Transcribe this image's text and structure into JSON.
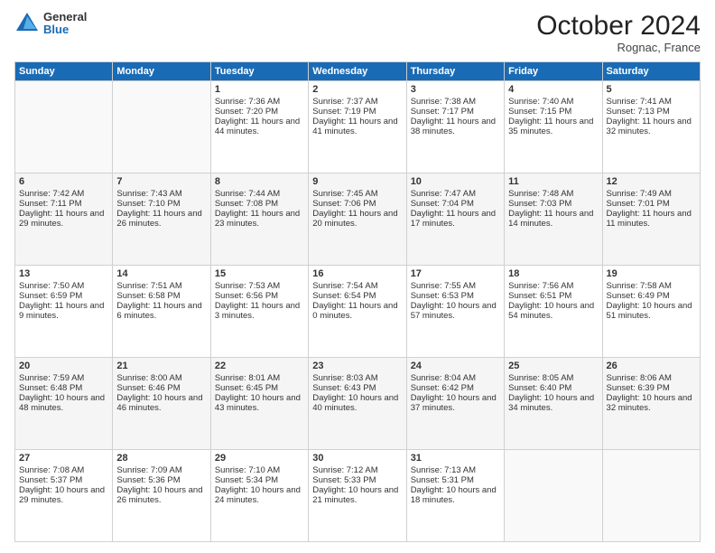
{
  "logo": {
    "general": "General",
    "blue": "Blue"
  },
  "header": {
    "month": "October 2024",
    "location": "Rognac, France"
  },
  "weekdays": [
    "Sunday",
    "Monday",
    "Tuesday",
    "Wednesday",
    "Thursday",
    "Friday",
    "Saturday"
  ],
  "weeks": [
    [
      {
        "day": "",
        "sunrise": "",
        "sunset": "",
        "daylight": ""
      },
      {
        "day": "",
        "sunrise": "",
        "sunset": "",
        "daylight": ""
      },
      {
        "day": "1",
        "sunrise": "Sunrise: 7:36 AM",
        "sunset": "Sunset: 7:20 PM",
        "daylight": "Daylight: 11 hours and 44 minutes."
      },
      {
        "day": "2",
        "sunrise": "Sunrise: 7:37 AM",
        "sunset": "Sunset: 7:19 PM",
        "daylight": "Daylight: 11 hours and 41 minutes."
      },
      {
        "day": "3",
        "sunrise": "Sunrise: 7:38 AM",
        "sunset": "Sunset: 7:17 PM",
        "daylight": "Daylight: 11 hours and 38 minutes."
      },
      {
        "day": "4",
        "sunrise": "Sunrise: 7:40 AM",
        "sunset": "Sunset: 7:15 PM",
        "daylight": "Daylight: 11 hours and 35 minutes."
      },
      {
        "day": "5",
        "sunrise": "Sunrise: 7:41 AM",
        "sunset": "Sunset: 7:13 PM",
        "daylight": "Daylight: 11 hours and 32 minutes."
      }
    ],
    [
      {
        "day": "6",
        "sunrise": "Sunrise: 7:42 AM",
        "sunset": "Sunset: 7:11 PM",
        "daylight": "Daylight: 11 hours and 29 minutes."
      },
      {
        "day": "7",
        "sunrise": "Sunrise: 7:43 AM",
        "sunset": "Sunset: 7:10 PM",
        "daylight": "Daylight: 11 hours and 26 minutes."
      },
      {
        "day": "8",
        "sunrise": "Sunrise: 7:44 AM",
        "sunset": "Sunset: 7:08 PM",
        "daylight": "Daylight: 11 hours and 23 minutes."
      },
      {
        "day": "9",
        "sunrise": "Sunrise: 7:45 AM",
        "sunset": "Sunset: 7:06 PM",
        "daylight": "Daylight: 11 hours and 20 minutes."
      },
      {
        "day": "10",
        "sunrise": "Sunrise: 7:47 AM",
        "sunset": "Sunset: 7:04 PM",
        "daylight": "Daylight: 11 hours and 17 minutes."
      },
      {
        "day": "11",
        "sunrise": "Sunrise: 7:48 AM",
        "sunset": "Sunset: 7:03 PM",
        "daylight": "Daylight: 11 hours and 14 minutes."
      },
      {
        "day": "12",
        "sunrise": "Sunrise: 7:49 AM",
        "sunset": "Sunset: 7:01 PM",
        "daylight": "Daylight: 11 hours and 11 minutes."
      }
    ],
    [
      {
        "day": "13",
        "sunrise": "Sunrise: 7:50 AM",
        "sunset": "Sunset: 6:59 PM",
        "daylight": "Daylight: 11 hours and 9 minutes."
      },
      {
        "day": "14",
        "sunrise": "Sunrise: 7:51 AM",
        "sunset": "Sunset: 6:58 PM",
        "daylight": "Daylight: 11 hours and 6 minutes."
      },
      {
        "day": "15",
        "sunrise": "Sunrise: 7:53 AM",
        "sunset": "Sunset: 6:56 PM",
        "daylight": "Daylight: 11 hours and 3 minutes."
      },
      {
        "day": "16",
        "sunrise": "Sunrise: 7:54 AM",
        "sunset": "Sunset: 6:54 PM",
        "daylight": "Daylight: 11 hours and 0 minutes."
      },
      {
        "day": "17",
        "sunrise": "Sunrise: 7:55 AM",
        "sunset": "Sunset: 6:53 PM",
        "daylight": "Daylight: 10 hours and 57 minutes."
      },
      {
        "day": "18",
        "sunrise": "Sunrise: 7:56 AM",
        "sunset": "Sunset: 6:51 PM",
        "daylight": "Daylight: 10 hours and 54 minutes."
      },
      {
        "day": "19",
        "sunrise": "Sunrise: 7:58 AM",
        "sunset": "Sunset: 6:49 PM",
        "daylight": "Daylight: 10 hours and 51 minutes."
      }
    ],
    [
      {
        "day": "20",
        "sunrise": "Sunrise: 7:59 AM",
        "sunset": "Sunset: 6:48 PM",
        "daylight": "Daylight: 10 hours and 48 minutes."
      },
      {
        "day": "21",
        "sunrise": "Sunrise: 8:00 AM",
        "sunset": "Sunset: 6:46 PM",
        "daylight": "Daylight: 10 hours and 46 minutes."
      },
      {
        "day": "22",
        "sunrise": "Sunrise: 8:01 AM",
        "sunset": "Sunset: 6:45 PM",
        "daylight": "Daylight: 10 hours and 43 minutes."
      },
      {
        "day": "23",
        "sunrise": "Sunrise: 8:03 AM",
        "sunset": "Sunset: 6:43 PM",
        "daylight": "Daylight: 10 hours and 40 minutes."
      },
      {
        "day": "24",
        "sunrise": "Sunrise: 8:04 AM",
        "sunset": "Sunset: 6:42 PM",
        "daylight": "Daylight: 10 hours and 37 minutes."
      },
      {
        "day": "25",
        "sunrise": "Sunrise: 8:05 AM",
        "sunset": "Sunset: 6:40 PM",
        "daylight": "Daylight: 10 hours and 34 minutes."
      },
      {
        "day": "26",
        "sunrise": "Sunrise: 8:06 AM",
        "sunset": "Sunset: 6:39 PM",
        "daylight": "Daylight: 10 hours and 32 minutes."
      }
    ],
    [
      {
        "day": "27",
        "sunrise": "Sunrise: 7:08 AM",
        "sunset": "Sunset: 5:37 PM",
        "daylight": "Daylight: 10 hours and 29 minutes."
      },
      {
        "day": "28",
        "sunrise": "Sunrise: 7:09 AM",
        "sunset": "Sunset: 5:36 PM",
        "daylight": "Daylight: 10 hours and 26 minutes."
      },
      {
        "day": "29",
        "sunrise": "Sunrise: 7:10 AM",
        "sunset": "Sunset: 5:34 PM",
        "daylight": "Daylight: 10 hours and 24 minutes."
      },
      {
        "day": "30",
        "sunrise": "Sunrise: 7:12 AM",
        "sunset": "Sunset: 5:33 PM",
        "daylight": "Daylight: 10 hours and 21 minutes."
      },
      {
        "day": "31",
        "sunrise": "Sunrise: 7:13 AM",
        "sunset": "Sunset: 5:31 PM",
        "daylight": "Daylight: 10 hours and 18 minutes."
      },
      {
        "day": "",
        "sunrise": "",
        "sunset": "",
        "daylight": ""
      },
      {
        "day": "",
        "sunrise": "",
        "sunset": "",
        "daylight": ""
      }
    ]
  ]
}
